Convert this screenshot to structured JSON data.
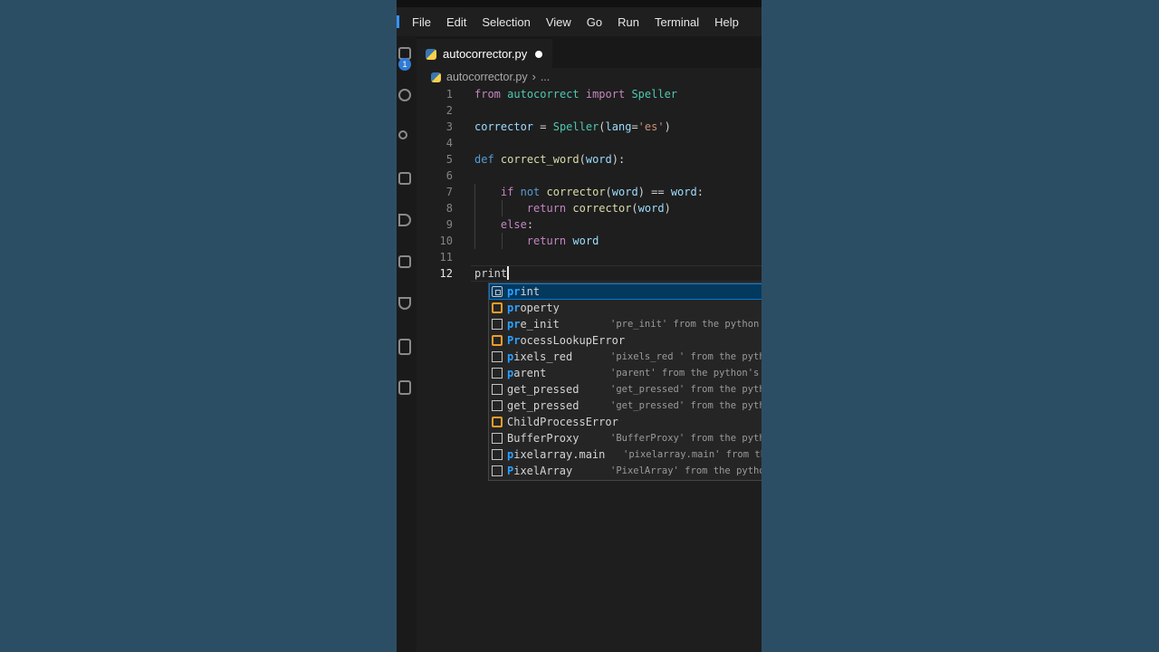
{
  "menu": [
    "File",
    "Edit",
    "Selection",
    "View",
    "Go",
    "Run",
    "Terminal",
    "Help"
  ],
  "activity": {
    "badge": "1"
  },
  "tab": {
    "label": "autocorrector.py"
  },
  "breadcrumb": {
    "file": "autocorrector.py",
    "sep": "›",
    "rest": "..."
  },
  "editor": {
    "line_numbers": [
      "1",
      "2",
      "3",
      "4",
      "5",
      "6",
      "7",
      "8",
      "9",
      "10",
      "11",
      "12"
    ],
    "active_line": "12",
    "lines": [
      [
        [
          "kw",
          "from"
        ],
        [
          "op",
          " "
        ],
        [
          "cls",
          "autocorrect"
        ],
        [
          "op",
          " "
        ],
        [
          "kw",
          "import"
        ],
        [
          "op",
          " "
        ],
        [
          "cls",
          "Speller"
        ]
      ],
      [],
      [
        [
          "var",
          "corrector"
        ],
        [
          "op",
          " = "
        ],
        [
          "cls",
          "Speller"
        ],
        [
          "op",
          "("
        ],
        [
          "var",
          "lang"
        ],
        [
          "op",
          "="
        ],
        [
          "str",
          "'es'"
        ],
        [
          "op",
          ")"
        ]
      ],
      [],
      [
        [
          "kw2",
          "def"
        ],
        [
          "op",
          " "
        ],
        [
          "fn",
          "correct_word"
        ],
        [
          "op",
          "("
        ],
        [
          "var",
          "word"
        ],
        [
          "op",
          "):"
        ]
      ],
      [],
      [
        [
          "op",
          "    "
        ],
        [
          "kw",
          "if"
        ],
        [
          "op",
          " "
        ],
        [
          "kw2",
          "not"
        ],
        [
          "op",
          " "
        ],
        [
          "fn",
          "corrector"
        ],
        [
          "op",
          "("
        ],
        [
          "var",
          "word"
        ],
        [
          "op",
          ") == "
        ],
        [
          "var",
          "word"
        ],
        [
          "op",
          ":"
        ]
      ],
      [
        [
          "op",
          "        "
        ],
        [
          "kw",
          "return"
        ],
        [
          "op",
          " "
        ],
        [
          "fn",
          "corrector"
        ],
        [
          "op",
          "("
        ],
        [
          "var",
          "word"
        ],
        [
          "op",
          ")"
        ]
      ],
      [
        [
          "op",
          "    "
        ],
        [
          "kw",
          "else"
        ],
        [
          "op",
          ":"
        ]
      ],
      [
        [
          "op",
          "        "
        ],
        [
          "kw",
          "return"
        ],
        [
          "op",
          " "
        ],
        [
          "var",
          "word"
        ]
      ],
      [],
      [
        [
          "op",
          "print"
        ]
      ]
    ]
  },
  "suggestions": [
    {
      "kind": "method",
      "match": "pr",
      "rest": "int",
      "detail": ""
    },
    {
      "kind": "klass",
      "match": "pr",
      "rest": "operty",
      "detail": ""
    },
    {
      "kind": "text",
      "match": "pr",
      "rest": "e_init",
      "detail": "'pre_init' from the python's"
    },
    {
      "kind": "klass",
      "match": "Pr",
      "rest": "ocessLookupError",
      "detail": ""
    },
    {
      "kind": "text",
      "match": "p",
      "rest": "ixels_red",
      "detail": "'pixels_red ' from the pytho"
    },
    {
      "kind": "text",
      "match": "p",
      "rest": "arent",
      "detail": "'parent' from the python's"
    },
    {
      "kind": "text",
      "match": "",
      "rest": "get_pressed",
      "detail": "'get_pressed' from the pytho"
    },
    {
      "kind": "text",
      "match": "",
      "rest": "get_pressed",
      "detail": "'get_pressed' from the pytho"
    },
    {
      "kind": "klass",
      "match": "",
      "rest": "ChildProcessError",
      "detail": ""
    },
    {
      "kind": "text",
      "match": "",
      "rest": "BufferProxy",
      "detail": "'BufferProxy' from the pytho"
    },
    {
      "kind": "text",
      "match": "p",
      "rest": "ixelarray.main",
      "detail": "'pixelarray.main' from th"
    },
    {
      "kind": "text",
      "match": "P",
      "rest": "ixelArray",
      "detail": "'PixelArray' from the pytho"
    }
  ]
}
